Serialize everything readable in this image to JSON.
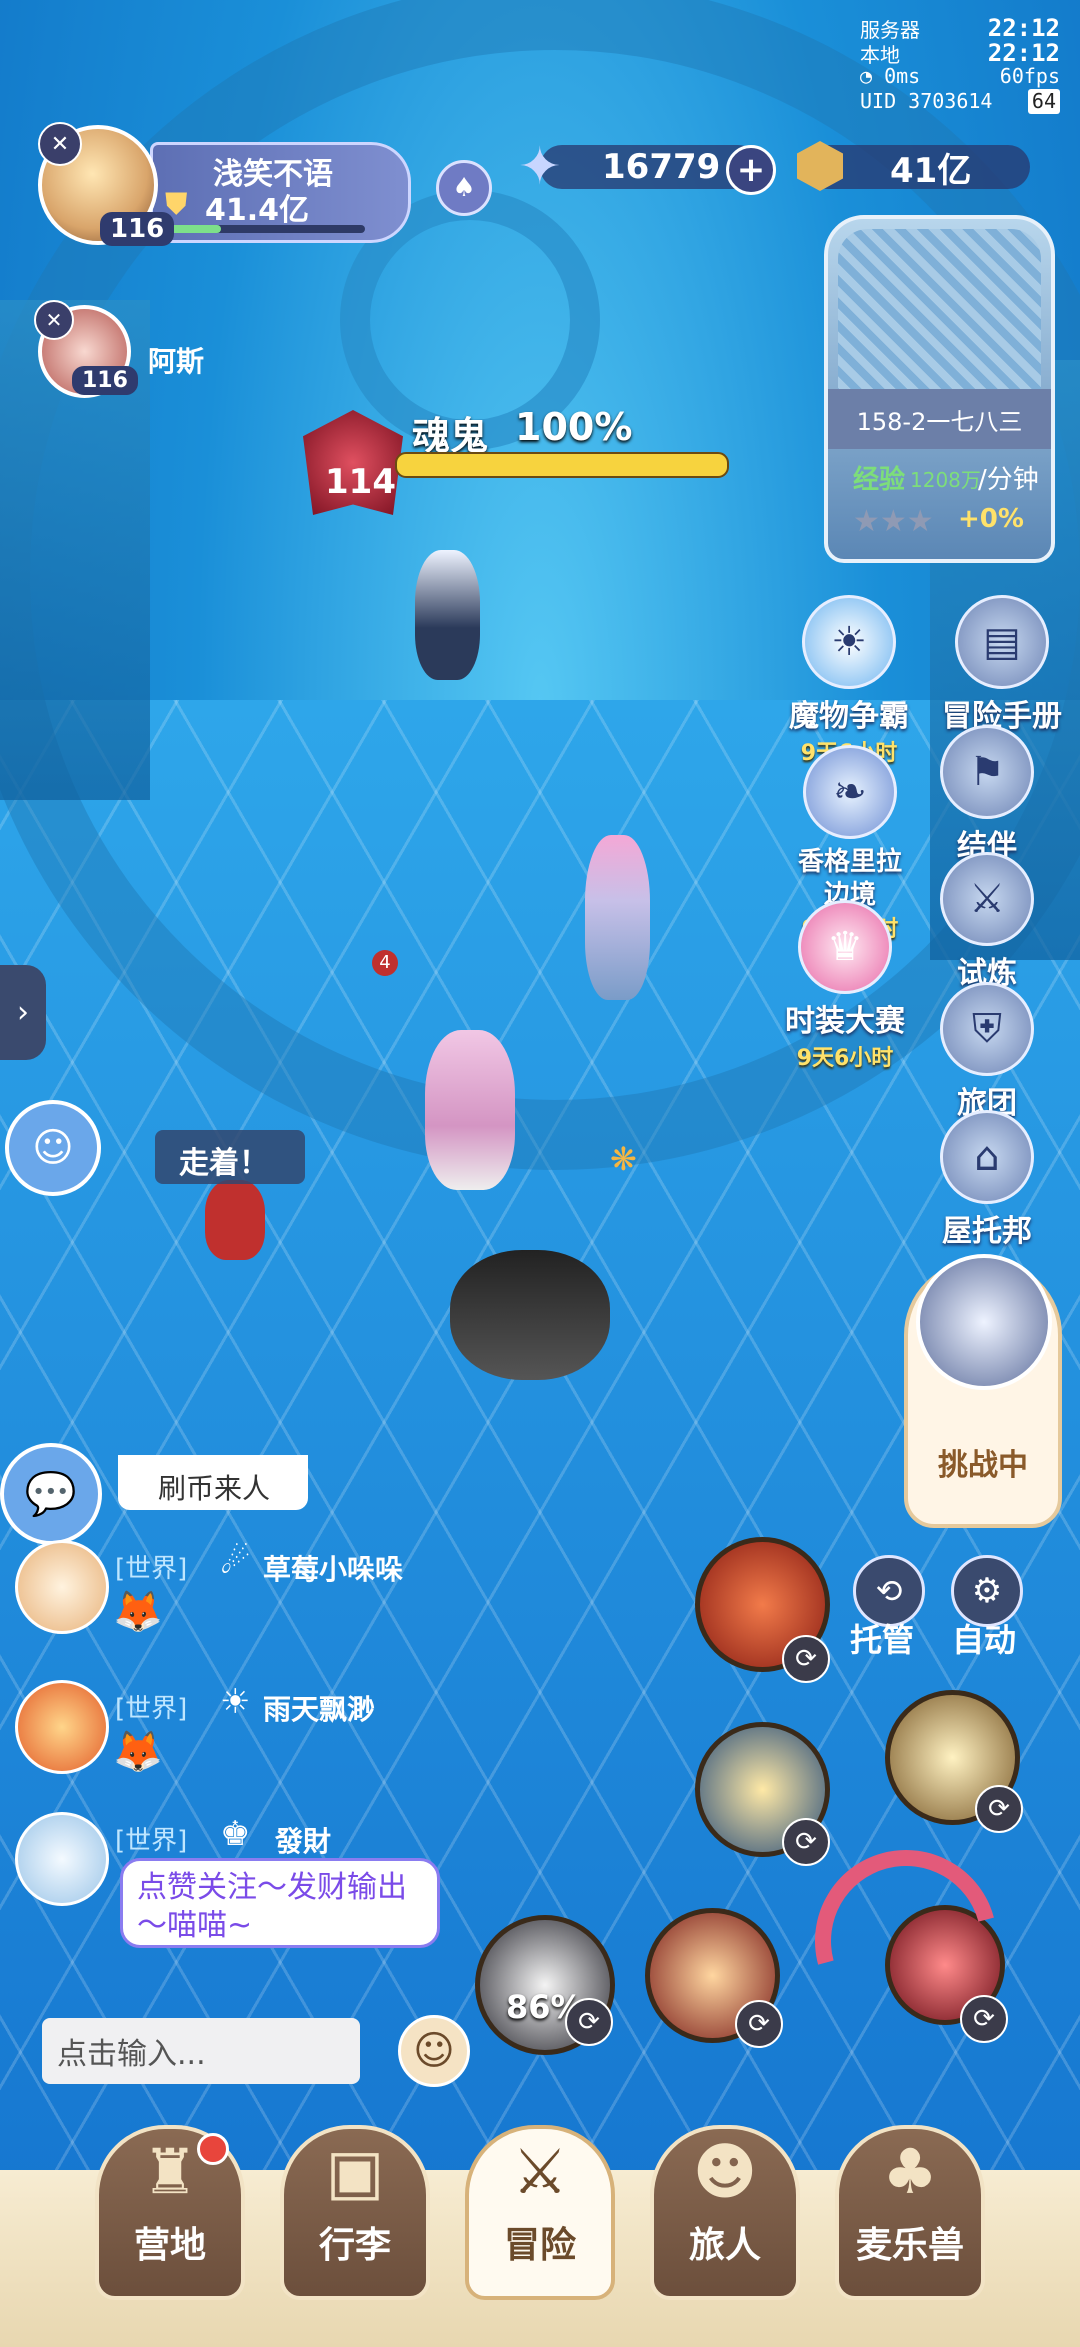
{
  "status": {
    "server_label": "服务器",
    "server_time": "22:12",
    "local_label": "本地",
    "local_time": "22:12",
    "ping": "0ms",
    "fps": "60fps",
    "uid": "UID 3703614",
    "battery": "64"
  },
  "player": {
    "name": "浅笑不语",
    "power": "41.4亿",
    "level": "116"
  },
  "companion": {
    "name": "阿斯",
    "level": "116"
  },
  "currency": {
    "stars": "16779",
    "gold": "41亿"
  },
  "minimap": {
    "area": "158-2一七八三",
    "exp_label": "经验",
    "exp_value": "1208万",
    "exp_unit": "/分钟",
    "bonus": "+0%"
  },
  "boss": {
    "name": "魂鬼",
    "hp": "100%",
    "level": "114",
    "hp_fraction": 1.0
  },
  "events": [
    {
      "label": "魔物争霸",
      "timer": "9天6小时"
    },
    {
      "label": "香格里拉\n边境",
      "timer": "9天6小时"
    },
    {
      "label": "时装大赛",
      "timer": "9天6小时"
    }
  ],
  "side_menu": [
    {
      "label": "冒险手册"
    },
    {
      "label": "结伴"
    },
    {
      "label": "试炼"
    },
    {
      "label": "旅团"
    },
    {
      "label": "屋托邦"
    }
  ],
  "speech": "走着！",
  "damage_popup": "4",
  "challenge": {
    "label": "挑战中"
  },
  "chat": {
    "partial_text": "刷币来人",
    "messages": [
      {
        "channel": "[世界]",
        "name": "草莓小哚哚"
      },
      {
        "channel": "[世界]",
        "name": "雨天飘渺"
      },
      {
        "channel": "[世界]",
        "name": "發財"
      }
    ],
    "bubble_text": "点赞关注～发财输出～喵喵~",
    "input_placeholder": "点击输入..."
  },
  "controls": {
    "auto_manage": "托管",
    "auto": "自动",
    "ultimate_percent": "86%"
  },
  "nav": [
    {
      "label": "营地",
      "badge": true
    },
    {
      "label": "行李",
      "badge": false
    },
    {
      "label": "冒险",
      "badge": false
    },
    {
      "label": "旅人",
      "badge": false
    },
    {
      "label": "麦乐兽",
      "badge": false
    }
  ],
  "colors": {
    "boss_hp": "#f7d33e",
    "timer": "#ffe26a",
    "exp_green": "#7dde7a",
    "nav_active": "#fffaf0",
    "badge_red": "#e8453c"
  }
}
